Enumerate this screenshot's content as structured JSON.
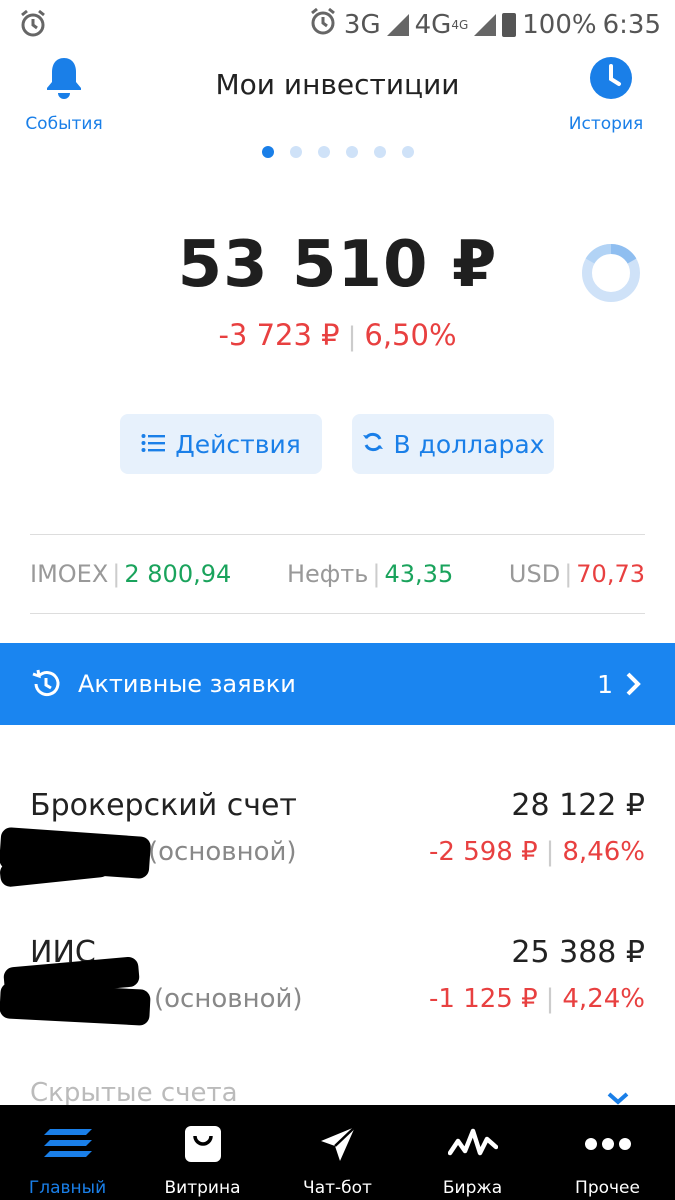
{
  "status_bar": {
    "network_1": "3G",
    "network_2": "4G",
    "network_2_sup": "4G",
    "battery": "100%",
    "time": "6:35"
  },
  "header": {
    "title": "Мои инвестиции",
    "left_label": "События",
    "right_label": "История",
    "left_icon": "bell-icon",
    "right_icon": "clock-icon"
  },
  "portfolio": {
    "total": "53 510 ₽",
    "change_abs": "-3 723 ₽",
    "change_pct": "6,50%"
  },
  "actions": {
    "actions_label": "Действия",
    "dollars_label": "В долларах"
  },
  "tickers": [
    {
      "name": "IMOEX",
      "value": "2 800,94",
      "trend": "up"
    },
    {
      "name": "Нефть",
      "value": "43,35",
      "trend": "up"
    },
    {
      "name": "USD",
      "value": "70,73",
      "trend": "down"
    }
  ],
  "orders_banner": {
    "label": "Активные заявки",
    "count": "1"
  },
  "accounts": [
    {
      "name": "Брокерский счет",
      "value": "28 122 ₽",
      "subtitle": "(основной)",
      "change_abs": "-2 598 ₽",
      "change_pct": "8,46%"
    },
    {
      "name": "ИИС",
      "value": "25 388 ₽",
      "subtitle": "(основной)",
      "change_abs": "-1 125 ₽",
      "change_pct": "4,24%"
    }
  ],
  "hidden_accounts_label": "Скрытые счета",
  "tabbar": [
    {
      "label": "Главный",
      "icon": "home-stack-icon",
      "active": true
    },
    {
      "label": "Витрина",
      "icon": "shopping-bag-icon",
      "active": false
    },
    {
      "label": "Чат-бот",
      "icon": "paper-plane-icon",
      "active": false
    },
    {
      "label": "Биржа",
      "icon": "pulse-icon",
      "active": false
    },
    {
      "label": "Прочее",
      "icon": "more-dots-icon",
      "active": false
    }
  ],
  "colors": {
    "accent": "#1a7fe8",
    "banner": "#1a85f0",
    "positive": "#1aa35c",
    "negative": "#e84040"
  }
}
